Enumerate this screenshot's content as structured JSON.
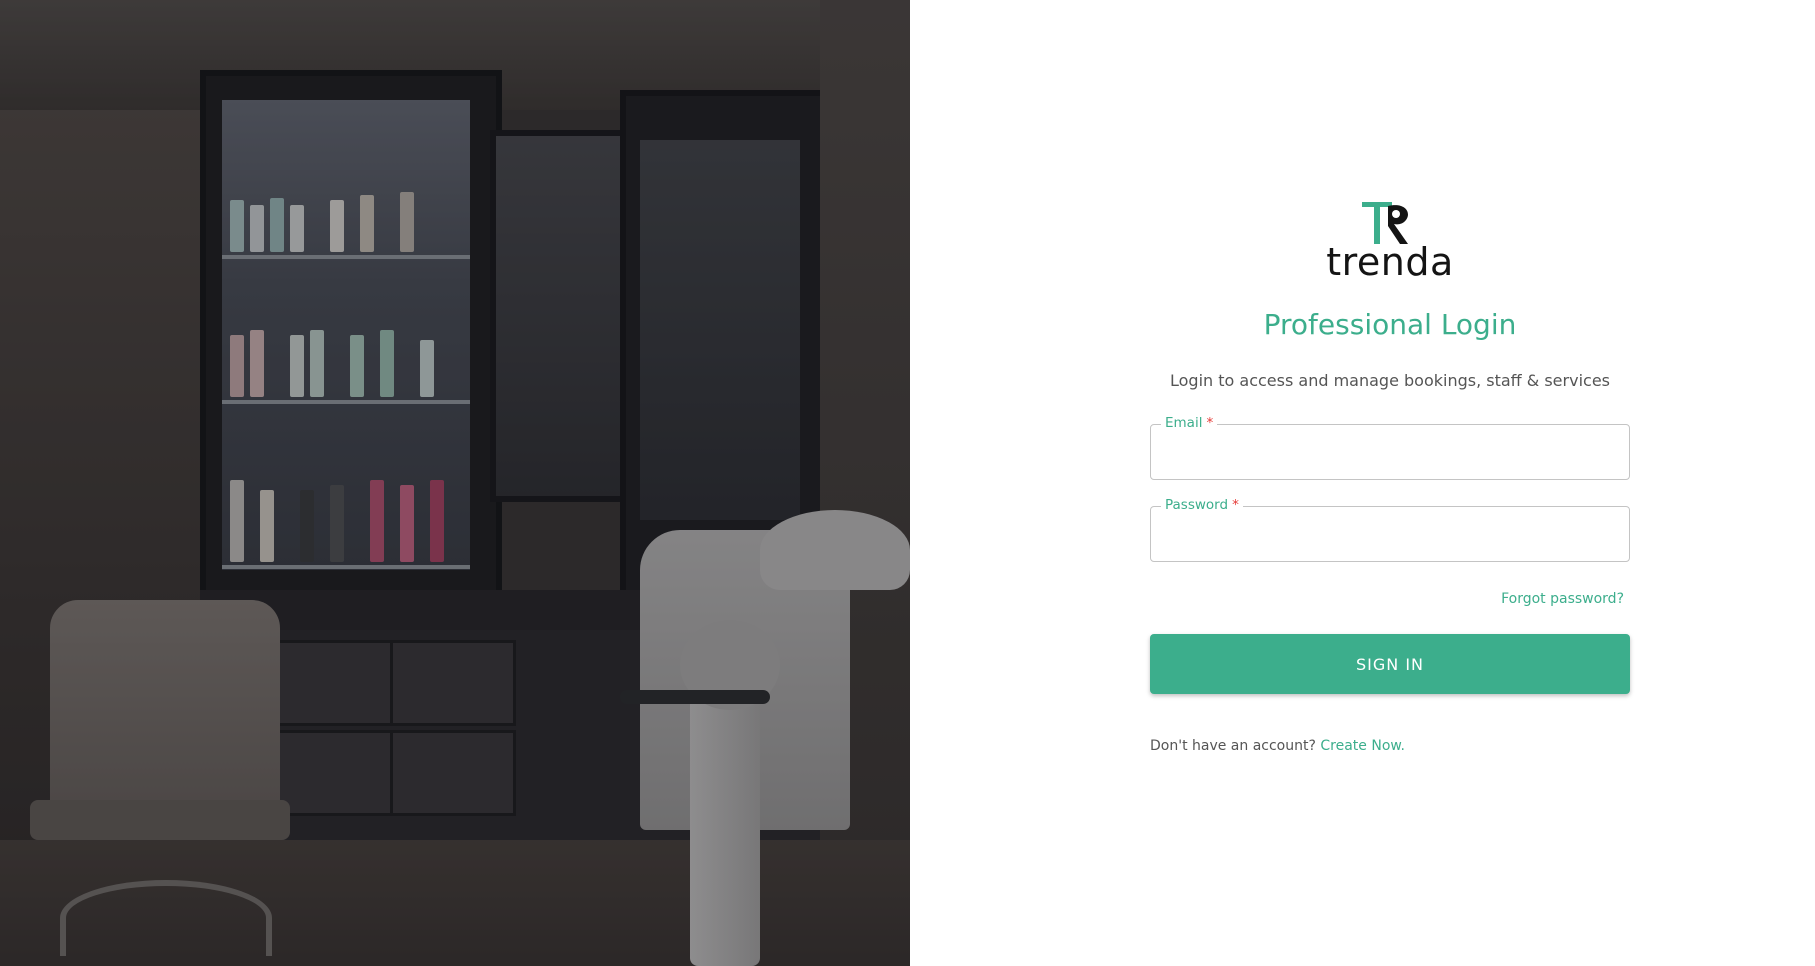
{
  "brand": {
    "name": "trenda",
    "logo_icon": "tr-monogram-icon",
    "accent_color": "#3cae8c"
  },
  "hero": {
    "image_subject": "salon-interior-photo"
  },
  "login": {
    "title": "Professional Login",
    "subtitle": "Login to access and manage bookings, staff & services",
    "email": {
      "label": "Email",
      "required_mark": "*",
      "value": ""
    },
    "password": {
      "label": "Password",
      "required_mark": "*",
      "value": ""
    },
    "forgot_password": "Forgot password?",
    "submit_label": "SIGN IN",
    "signup_prompt": "Don't have an account?",
    "signup_link": "Create Now."
  }
}
